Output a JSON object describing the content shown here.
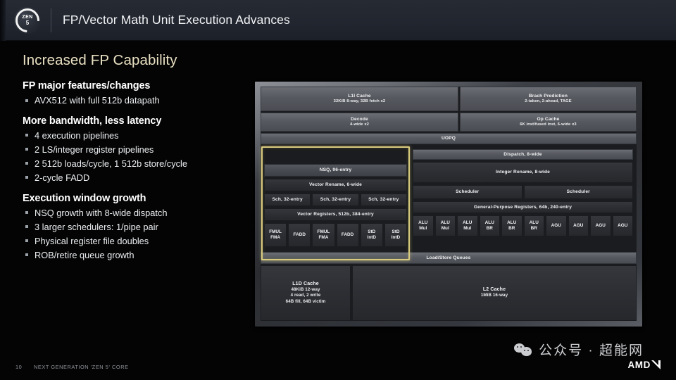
{
  "header": {
    "logo_word": "ZEN",
    "logo_num": "5",
    "title": "FP/Vector Math Unit Execution Advances"
  },
  "content": {
    "section_title": "Increased FP Capability",
    "groups": [
      {
        "heading": "FP major features/changes",
        "bullets": [
          "AVX512 with full 512b datapath"
        ]
      },
      {
        "heading": "More bandwidth, less latency",
        "bullets": [
          "4 execution pipelines",
          "2 LS/integer register pipelines",
          "2 512b loads/cycle, 1 512b store/cycle",
          "2-cycle FADD"
        ]
      },
      {
        "heading": "Execution window growth",
        "bullets": [
          "NSQ growth with 8-wide dispatch",
          "3 larger schedulers: 1/pipe pair",
          "Physical register file doubles",
          "ROB/retire queue growth"
        ]
      }
    ]
  },
  "diagram": {
    "highlight_color": "#d8cb7e",
    "front_end": {
      "l1i_cache": {
        "title": "L1I Cache",
        "detail": "32KiB 8-way, 32B fetch x2"
      },
      "branch_prediction": {
        "title": "Brach Prediction",
        "detail": "2-taken, 2-ahead, TAGE"
      },
      "decode": {
        "title": "Decode",
        "detail": "4-wide x2"
      },
      "op_cache": {
        "title": "Op Cache",
        "detail": "6K inst/fused inst, 6-wide x3"
      },
      "uopq": {
        "title": "UOPQ"
      }
    },
    "fp_block": {
      "nsq": {
        "title": "NSQ, 96-entry"
      },
      "vector_rename": {
        "title": "Vector Rename, 6-wide"
      },
      "schedulers": [
        {
          "title": "Sch, 32-entry"
        },
        {
          "title": "Sch, 32-entry"
        },
        {
          "title": "Sch, 32-entry"
        }
      ],
      "vector_registers": {
        "title": "Vector Registers, 512b, 384-entry"
      },
      "units": [
        {
          "l1": "FMUL",
          "l2": "FMA"
        },
        {
          "l1": "FADD",
          "l2": ""
        },
        {
          "l1": "FMUL",
          "l2": "FMA"
        },
        {
          "l1": "FADD",
          "l2": ""
        },
        {
          "l1": "StD",
          "l2": "IntD"
        },
        {
          "l1": "StD",
          "l2": "IntD"
        }
      ]
    },
    "integer_block": {
      "dispatch": {
        "title": "Dispatch, 8-wide"
      },
      "integer_rename": {
        "title": "Integer Rename, 8-wide"
      },
      "schedulers": [
        {
          "title": "Scheduler"
        },
        {
          "title": "Scheduler"
        }
      ],
      "gp_registers": {
        "title": "General-Purpose Registers, 64b, 240-entry"
      },
      "units": [
        {
          "l1": "ALU",
          "l2": "Mul"
        },
        {
          "l1": "ALU",
          "l2": "Mul"
        },
        {
          "l1": "ALU",
          "l2": "Mul"
        },
        {
          "l1": "ALU",
          "l2": "BR"
        },
        {
          "l1": "ALU",
          "l2": "BR"
        },
        {
          "l1": "ALU",
          "l2": "BR"
        },
        {
          "l1": "AGU",
          "l2": ""
        },
        {
          "l1": "AGU",
          "l2": ""
        },
        {
          "l1": "AGU",
          "l2": ""
        },
        {
          "l1": "AGU",
          "l2": ""
        }
      ]
    },
    "memory": {
      "lsq": {
        "title": "Load/Store Queues"
      },
      "l1d_cache": {
        "title": "L1D Cache",
        "detail_lines": [
          "48KiB 12-way",
          "4 read, 2 write",
          "64B fill, 64B victim"
        ]
      },
      "l2_cache": {
        "title": "L2 Cache",
        "detail_lines": [
          "1MiB 16-way"
        ]
      }
    }
  },
  "footer": {
    "page_number": "10",
    "text": "NEXT GENERATION 'ZEN 5' CORE"
  },
  "watermark": {
    "text": "公众号 · 超能网",
    "brand": "AMD"
  }
}
